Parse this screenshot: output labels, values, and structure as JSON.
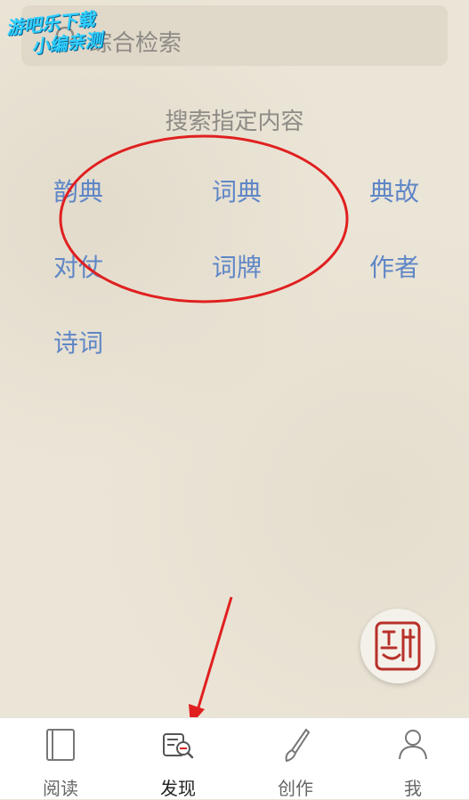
{
  "search": {
    "placeholder_text": "综合检索"
  },
  "watermark": {
    "line1": "游吧乐下载",
    "line2": "小编亲测"
  },
  "section": {
    "title": "搜索指定内容"
  },
  "categories": [
    {
      "label": "韵典"
    },
    {
      "label": "词典"
    },
    {
      "label": "典故"
    },
    {
      "label": "对仗"
    },
    {
      "label": "词牌"
    },
    {
      "label": "作者"
    },
    {
      "label": "诗词"
    }
  ],
  "tabs": [
    {
      "label": "阅读",
      "icon": "book-icon"
    },
    {
      "label": "发现",
      "icon": "discover-icon",
      "active": true
    },
    {
      "label": "创作",
      "icon": "brush-icon"
    },
    {
      "label": "我",
      "icon": "user-icon"
    }
  ],
  "colors": {
    "accent_blue": "#5f86c6",
    "annotation_red": "#e02020"
  }
}
